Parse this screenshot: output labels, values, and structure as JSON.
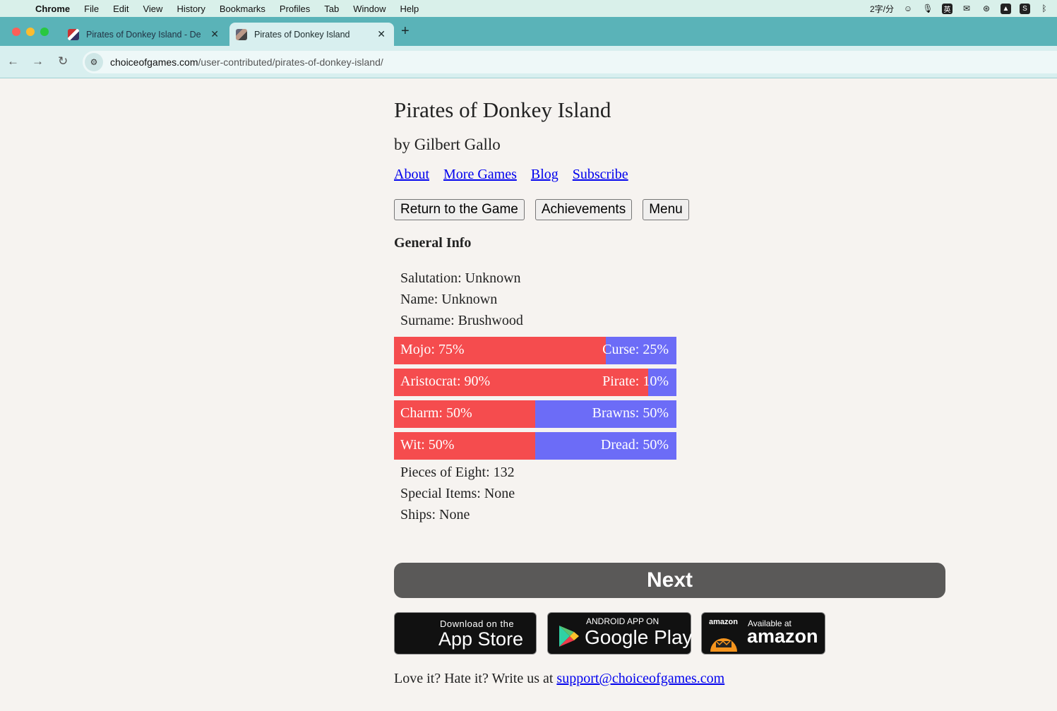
{
  "menubar": {
    "app": "Chrome",
    "items": [
      "File",
      "Edit",
      "View",
      "History",
      "Bookmarks",
      "Profiles",
      "Tab",
      "Window",
      "Help"
    ],
    "status_text": "2字/分"
  },
  "tabs": [
    {
      "title": "Pirates of Donkey Island - De",
      "active": false
    },
    {
      "title": "Pirates of Donkey Island",
      "active": true
    }
  ],
  "address": {
    "host": "choiceofgames.com",
    "path": "/user-contributed/pirates-of-donkey-island/"
  },
  "game": {
    "title": "Pirates of Donkey Island",
    "author": "by Gilbert Gallo",
    "links": [
      "About",
      "More Games",
      "Blog",
      "Subscribe"
    ],
    "buttons": {
      "return": "Return to the Game",
      "achievements": "Achievements",
      "menu": "Menu"
    },
    "section": "General Info",
    "stats_top": [
      "Salutation: Unknown",
      "Name: Unknown",
      "Surname: Brushwood"
    ],
    "bars": [
      {
        "left": "Mojo: 75%",
        "right": "Curse: 25%",
        "left_fraction": 0.75
      },
      {
        "left": "Aristocrat: 90%",
        "right": "Pirate: 10%",
        "left_fraction": 0.9
      },
      {
        "left": "Charm: 50%",
        "right": "Brawns: 50%",
        "left_fraction": 0.5
      },
      {
        "left": "Wit: 50%",
        "right": "Dread: 50%",
        "left_fraction": 0.5
      }
    ],
    "stats_bottom": [
      "Pieces of Eight: 132",
      "Special Items: None",
      "Ships: None"
    ],
    "next": "Next",
    "badges": {
      "appstore_small": "Download on the",
      "appstore_big": "App Store",
      "google_small": "ANDROID APP ON",
      "google_big": "Google Play",
      "amazon_logo": "amazon",
      "amazon_small": "Available at",
      "amazon_big": "amazon"
    },
    "footer_text": "Love it? Hate it? Write us at ",
    "footer_email": "support@choiceofgames.com"
  },
  "colors": {
    "bar_left": "#f54c4e",
    "bar_right": "#6c6cf7",
    "next_bg": "#5a5958",
    "link": "#0000ee"
  }
}
